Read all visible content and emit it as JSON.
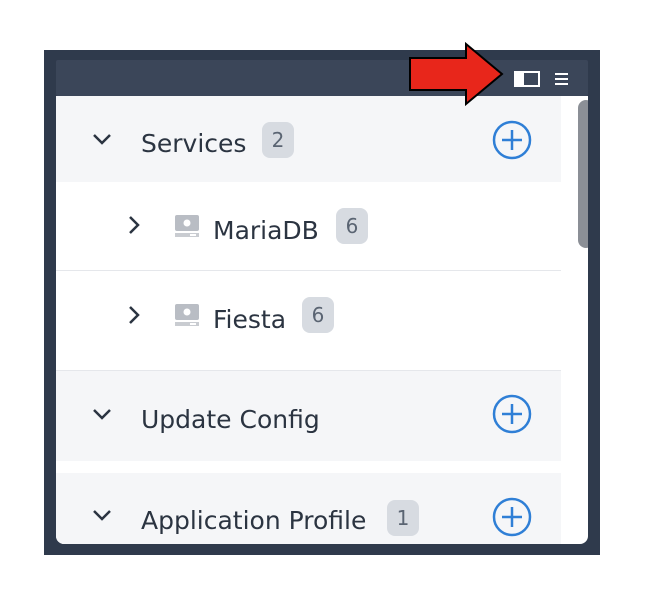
{
  "toolbar": {
    "icons": [
      "sidebar-panel-icon",
      "menu-icon"
    ]
  },
  "sections": [
    {
      "name": "services",
      "label": "Services",
      "badge": "2",
      "expanded": true
    },
    {
      "name": "update-config",
      "label": "Update Config",
      "badge": null,
      "expanded": true
    },
    {
      "name": "application-profile",
      "label": "Application Profile",
      "badge": "1",
      "expanded": true
    }
  ],
  "services": [
    {
      "label": "MariaDB",
      "badge": "6",
      "icon": "service-icon"
    },
    {
      "label": "Fiesta",
      "badge": "6",
      "icon": "service-icon"
    }
  ],
  "colors": {
    "frame": "#2f3a4c",
    "accent": "#2f7fd6",
    "annotation_arrow": "#e8261b"
  }
}
